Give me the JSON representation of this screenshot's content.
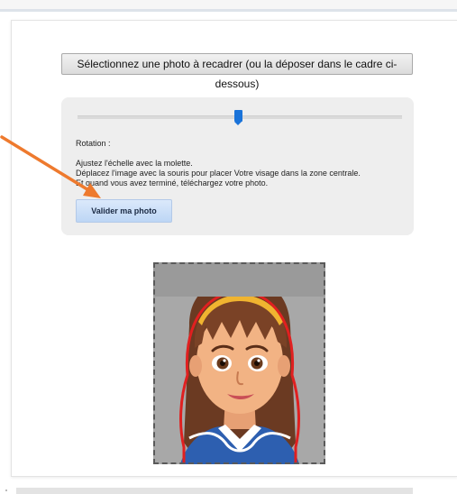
{
  "upload": {
    "select_label": "Sélectionnez une photo à recadrer (ou la déposer dans le cadre ci-dessous)"
  },
  "controls": {
    "scale_slider_value": 0.49,
    "rotation_label": "Rotation :",
    "instructions": [
      "Ajustez l'échelle avec la molette.",
      "Déplacez l'image avec la souris pour placer Votre visage dans la zone centrale.",
      "Et quand vous avez terminé, téléchargez votre photo."
    ],
    "validate_label": "Valider ma photo"
  },
  "preview": {
    "image_description_icon": "avatar-girl-illustration",
    "guide_color": "#e02020"
  },
  "colors": {
    "accent": "#1a73d9",
    "arrow": "#ee7a2e",
    "button_blue": "#bdd6f5"
  }
}
